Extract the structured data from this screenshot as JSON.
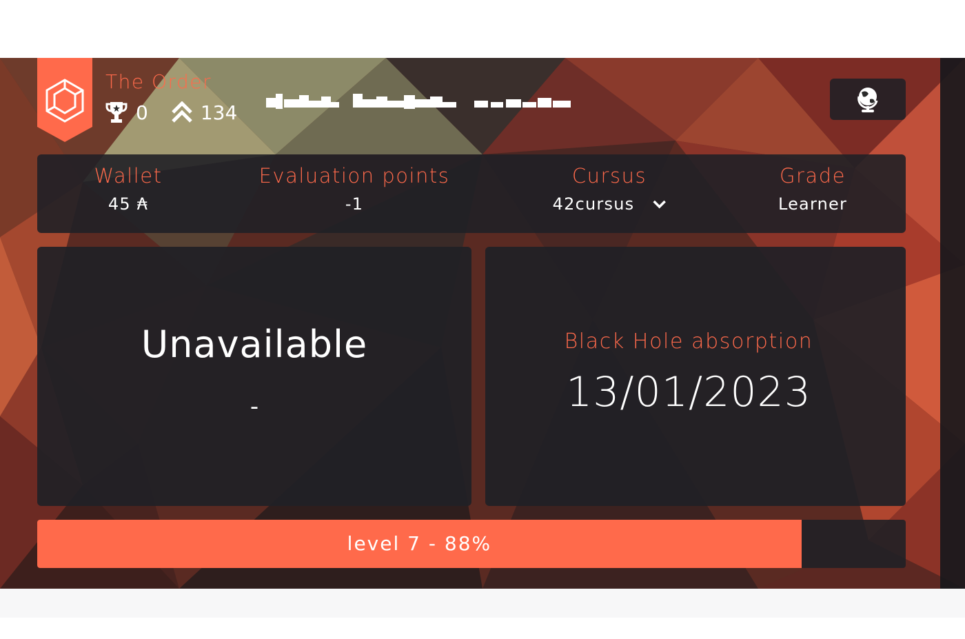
{
  "colors": {
    "accent": "#ff6a4b",
    "panel": "#202026"
  },
  "coalition": {
    "name": "The Order",
    "icon": "hexagon-cube-icon"
  },
  "header_stats": {
    "achievements": "0",
    "achievements_icon": "trophy-icon",
    "correction_points": "134",
    "correction_icon": "double-chevron-up-icon"
  },
  "globe": {
    "icon": "globe-icon"
  },
  "info": {
    "wallet_label": "Wallet",
    "wallet_value": "45 ₳",
    "eval_label": "Evaluation points",
    "eval_value": "-1",
    "cursus_label": "Cursus",
    "cursus_value": "42cursus",
    "grade_label": "Grade",
    "grade_value": "Learner"
  },
  "left_panel": {
    "status": "Unavailable",
    "sub": "-"
  },
  "right_panel": {
    "label": "Black Hole absorption",
    "date": "13/01/2023"
  },
  "level": {
    "text": "level 7 - 88%",
    "progress": 0.88
  }
}
